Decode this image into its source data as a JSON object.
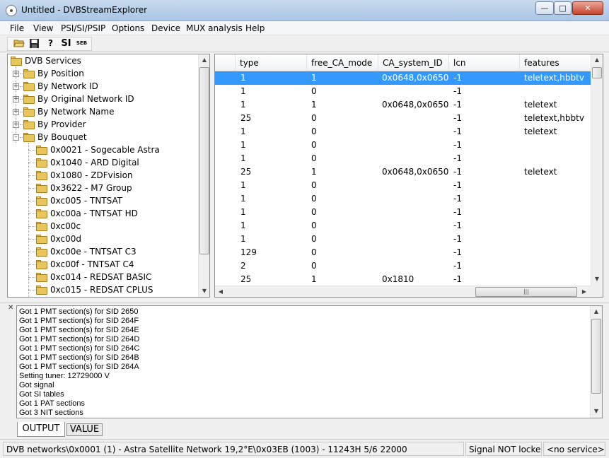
{
  "window": {
    "title": "Untitled - DVBStreamExplorer"
  },
  "menu": [
    "File",
    "View",
    "PSI/SI/PSIP",
    "Options",
    "Device",
    "MUX analysis",
    "Help"
  ],
  "toolbar": {
    "si_label": "SI",
    "seb_label": "SEB",
    "help_label": "?"
  },
  "tree": {
    "root": "DVB Services",
    "groups": [
      "By Position",
      "By Network ID",
      "By Original Network ID",
      "By Network Name",
      "By Provider",
      "By Bouquet"
    ],
    "bouquets": [
      "0x0021 - Sogecable Astra",
      "0x1040 - ARD Digital",
      "0x1080 - ZDFvision",
      "0x3622 - M7 Group",
      "0xc005 - TNTSAT",
      "0xc00a - TNTSAT HD",
      "0xc00c",
      "0xc00d",
      "0xc00e - TNTSAT C3",
      "0xc00f - TNTSAT C4",
      "0xc014 - REDSAT BASIC",
      "0xc015 - REDSAT CPLUS"
    ]
  },
  "table": {
    "columns": [
      "type",
      "free_CA_mode",
      "CA_system_ID",
      "lcn",
      "features"
    ],
    "rows": [
      [
        "1",
        "1",
        "0x0648,0x0650,...",
        "-1",
        "teletext,hbbtv"
      ],
      [
        "1",
        "0",
        "",
        "-1",
        ""
      ],
      [
        "1",
        "1",
        "0x0648,0x0650,...",
        "-1",
        "teletext"
      ],
      [
        "25",
        "0",
        "",
        "-1",
        "teletext,hbbtv"
      ],
      [
        "1",
        "0",
        "",
        "-1",
        "teletext"
      ],
      [
        "1",
        "0",
        "",
        "-1",
        ""
      ],
      [
        "1",
        "0",
        "",
        "-1",
        ""
      ],
      [
        "25",
        "1",
        "0x0648,0x0650,...",
        "-1",
        "teletext"
      ],
      [
        "1",
        "0",
        "",
        "-1",
        ""
      ],
      [
        "1",
        "0",
        "",
        "-1",
        ""
      ],
      [
        "1",
        "0",
        "",
        "-1",
        ""
      ],
      [
        "1",
        "0",
        "",
        "-1",
        ""
      ],
      [
        "1",
        "0",
        "",
        "-1",
        ""
      ],
      [
        "129",
        "0",
        "",
        "-1",
        ""
      ],
      [
        "2",
        "0",
        "",
        "-1",
        ""
      ],
      [
        "25",
        "1",
        "0x1810",
        "-1",
        ""
      ]
    ]
  },
  "log": [
    "Got 1 PMT section(s) for SID 2650",
    "Got 1 PMT section(s) for SID 264F",
    "Got 1 PMT section(s) for SID 264E",
    "Got 1 PMT section(s) for SID 264D",
    "Got 1 PMT section(s) for SID 264C",
    "Got 1 PMT section(s) for SID 264B",
    "Got 1 PMT section(s) for SID 264A",
    "Setting tuner: 12729000 V",
    "Got signal",
    "Got SI tables",
    "Got 1 PAT sections",
    "Got 3 NIT sections"
  ],
  "output_tabs": [
    "OUTPUT",
    "VALUE"
  ],
  "status": {
    "path": "DVB networks\\0x0001 (1) - Astra Satellite Network 19,2°E\\0x03EB (1003) - 11243H 5/6 22000",
    "signal": "Signal NOT locked",
    "service": "<no service>"
  },
  "icons": [
    "app-icon",
    "open-folder-icon",
    "save-icon",
    "help-icon",
    "folder-icon",
    "close-icon"
  ]
}
